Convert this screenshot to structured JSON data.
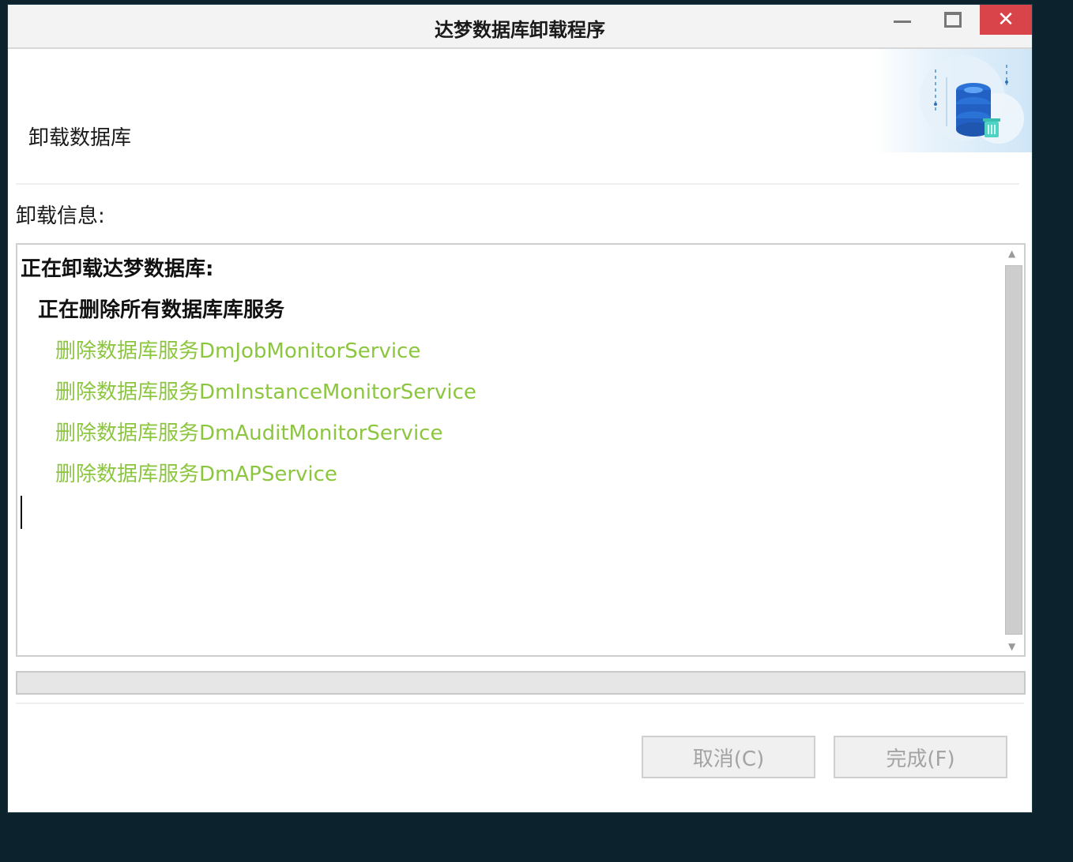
{
  "window": {
    "title": "达梦数据库卸载程序",
    "close_glyph": "✕"
  },
  "header": {
    "label": "卸载数据库",
    "icon": "database-trash-icon"
  },
  "info_label": "卸载信息:",
  "log": {
    "lines": [
      {
        "text": "正在卸载达梦数据库:",
        "style": "bold"
      },
      {
        "text": "正在删除所有数据库库服务",
        "style": "bold"
      },
      {
        "text": "删除数据库服务DmJobMonitorService",
        "style": "green"
      },
      {
        "text": "删除数据库服务DmInstanceMonitorService",
        "style": "green"
      },
      {
        "text": "删除数据库服务DmAuditMonitorService",
        "style": "green"
      },
      {
        "text": "删除数据库服务DmAPService",
        "style": "green"
      }
    ],
    "scroll_up_glyph": "▲",
    "scroll_down_glyph": "▼"
  },
  "progress": {
    "value": 0
  },
  "buttons": {
    "cancel": "取消(C)",
    "finish": "完成(F)"
  },
  "colors": {
    "accent_green": "#8cc63f",
    "close_red": "#d9434a",
    "desktop": "#0c222d"
  }
}
